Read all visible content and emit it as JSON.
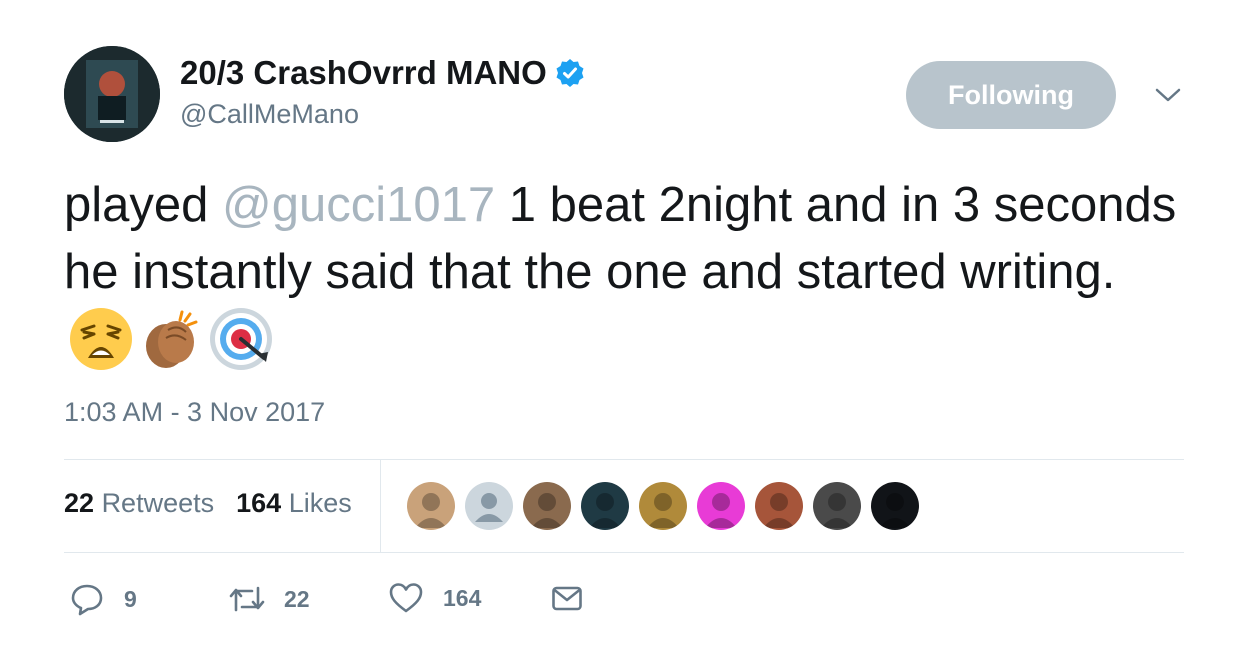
{
  "author": {
    "display_name": "20/3 CrashOvrrd MANO",
    "handle": "@CallMeMano",
    "verified": true
  },
  "follow_button": {
    "label": "Following"
  },
  "tweet": {
    "text_before": "played ",
    "mention": "@gucci1017",
    "text_after": " 1 beat 2night and in 3 seconds he instantly said that the one and started writing.",
    "emojis": [
      "weary-face-icon",
      "clapping-hands-icon",
      "direct-hit-icon"
    ],
    "timestamp": "1:03 AM - 3 Nov 2017"
  },
  "stats": {
    "retweets_count": "22",
    "retweets_label": "Retweets",
    "likes_count": "164",
    "likes_label": "Likes"
  },
  "likers": [
    {
      "name": "liker-1",
      "color": "#c9a27a"
    },
    {
      "name": "liker-2",
      "color": "#ccd6dd"
    },
    {
      "name": "liker-3",
      "color": "#8a6a4e"
    },
    {
      "name": "liker-4",
      "color": "#1f3a44"
    },
    {
      "name": "liker-5",
      "color": "#b08a3a"
    },
    {
      "name": "liker-6",
      "color": "#e83bd6"
    },
    {
      "name": "liker-7",
      "color": "#a6553a"
    },
    {
      "name": "liker-8",
      "color": "#4a4a4a"
    },
    {
      "name": "liker-9",
      "color": "#111418"
    }
  ],
  "actions": {
    "reply_count": "9",
    "retweet_count": "22",
    "like_count": "164"
  },
  "colors": {
    "verified_blue": "#1da1f2",
    "follow_button_bg": "#b8c4cc",
    "secondary_text": "#657786",
    "mention_text": "#a8b5bf"
  }
}
